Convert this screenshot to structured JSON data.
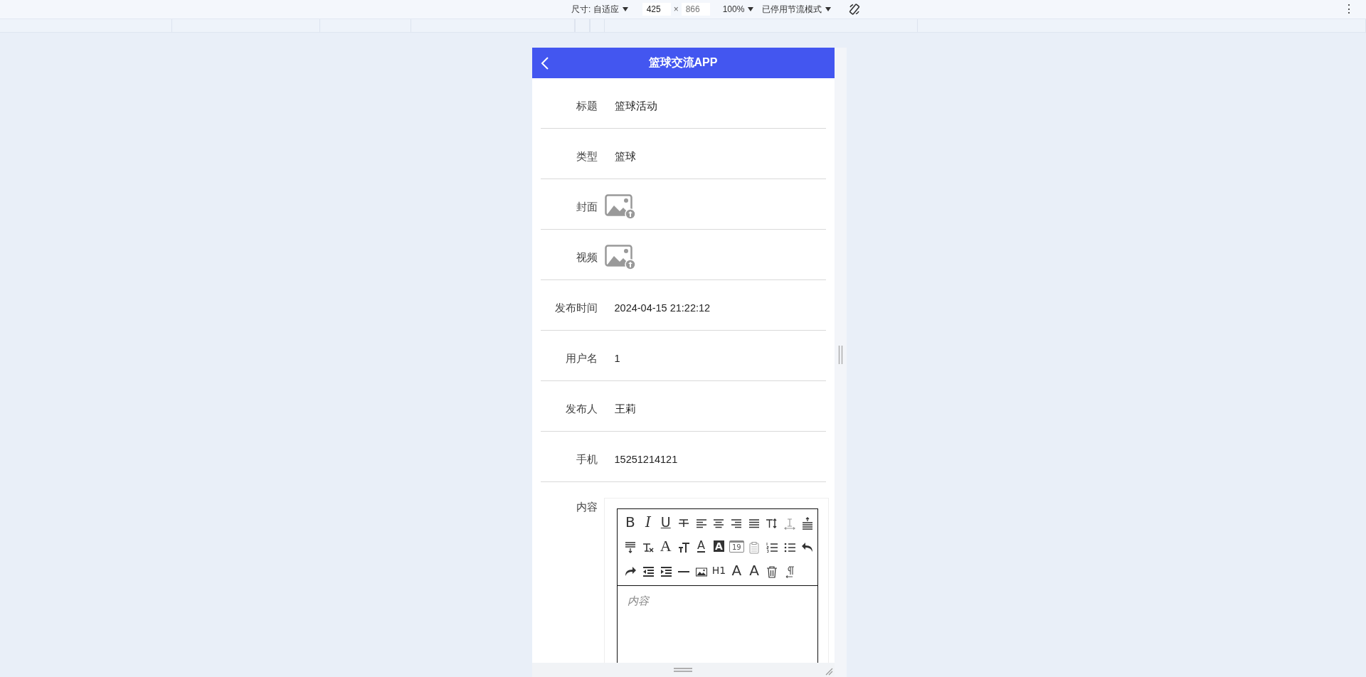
{
  "devtools_bar": {
    "dimensions_label": "尺寸: 自适应",
    "width_value": "425",
    "times": "×",
    "height_placeholder": "866",
    "zoom": "100%",
    "throttling": "已停用节流模式",
    "more": "⋮"
  },
  "header": {
    "title": "篮球交流APP"
  },
  "form_rows": [
    {
      "kind": "text",
      "label": "标题",
      "value": "篮球活动"
    },
    {
      "kind": "text",
      "label": "类型",
      "value": "篮球"
    },
    {
      "kind": "image",
      "label": "封面"
    },
    {
      "kind": "image",
      "label": "视频"
    },
    {
      "kind": "text",
      "label": "发布时间",
      "value": "2024-04-15 21:22:12"
    },
    {
      "kind": "text",
      "label": "用户名",
      "value": "1"
    },
    {
      "kind": "text",
      "label": "发布人",
      "value": "王莉"
    },
    {
      "kind": "text",
      "label": "手机",
      "value": "15251214121"
    },
    {
      "kind": "editor",
      "label": "内容",
      "placeholder": "内容"
    }
  ],
  "editor_toolbar": [
    {
      "kind": "bold",
      "label": "B"
    },
    {
      "kind": "italic",
      "label": "I"
    },
    {
      "kind": "underline",
      "label": "U"
    },
    {
      "kind": "strikethrough"
    },
    {
      "kind": "align-left"
    },
    {
      "kind": "align-center"
    },
    {
      "kind": "align-right"
    },
    {
      "kind": "justify"
    },
    {
      "kind": "line-height"
    },
    {
      "kind": "letter-spacing"
    },
    {
      "kind": "space-before"
    },
    {
      "kind": "space-after"
    },
    {
      "kind": "clear-format"
    },
    {
      "kind": "font-family",
      "label": "A"
    },
    {
      "kind": "font-size"
    },
    {
      "kind": "font-color",
      "label": "A"
    },
    {
      "kind": "back-color",
      "label": "A"
    },
    {
      "kind": "date",
      "label": "19"
    },
    {
      "kind": "clipboard"
    },
    {
      "kind": "ordered-list"
    },
    {
      "kind": "unordered-list"
    },
    {
      "kind": "undo"
    },
    {
      "kind": "redo"
    },
    {
      "kind": "outdent"
    },
    {
      "kind": "indent"
    },
    {
      "kind": "horizontal-rule"
    },
    {
      "kind": "image"
    },
    {
      "kind": "heading",
      "label": "H1"
    },
    {
      "kind": "subscript",
      "label": "A"
    },
    {
      "kind": "superscript",
      "label": "A"
    },
    {
      "kind": "delete"
    },
    {
      "kind": "paragraph"
    }
  ]
}
